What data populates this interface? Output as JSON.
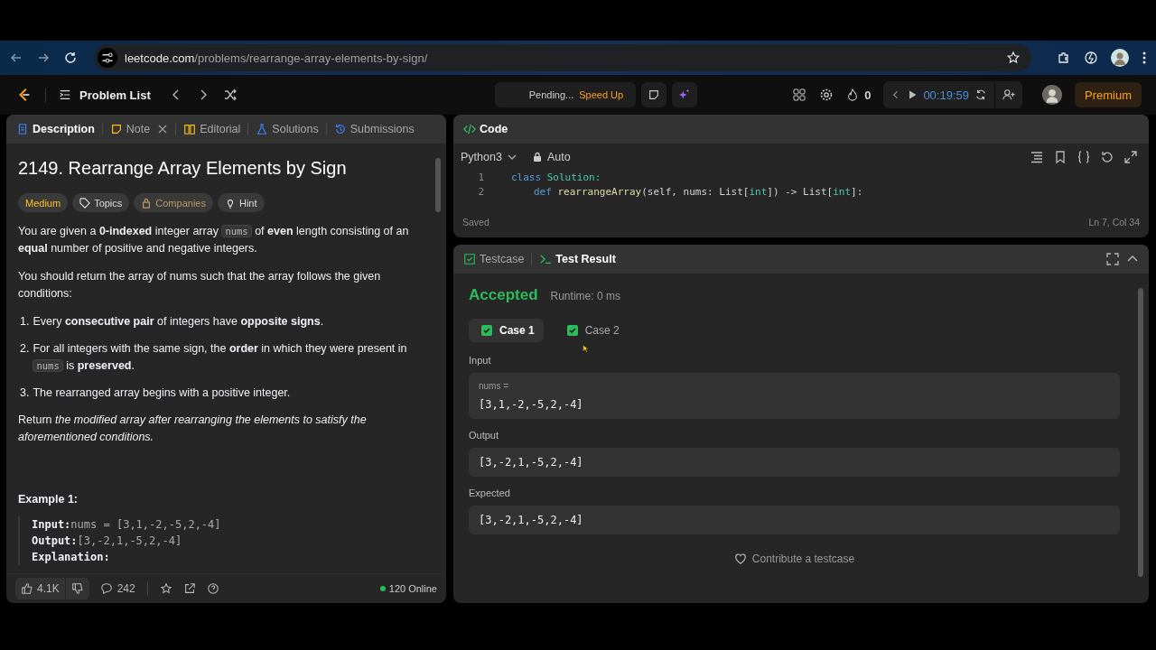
{
  "browser": {
    "url_host": "leetcode.com",
    "url_path": "/problems/rearrange-array-elements-by-sign/"
  },
  "nav": {
    "problem_list": "Problem List",
    "status": "Pending...",
    "speed_up": "Speed Up",
    "streak": "0",
    "timer": "00:19:59",
    "premium": "Premium"
  },
  "left_tabs": [
    {
      "label": "Description",
      "kind": "description",
      "selected": true,
      "closable": false
    },
    {
      "label": "Note",
      "kind": "note",
      "selected": false,
      "closable": true
    },
    {
      "label": "Editorial",
      "kind": "editorial",
      "selected": false,
      "closable": false
    },
    {
      "label": "Solutions",
      "kind": "solutions",
      "selected": false,
      "closable": false
    },
    {
      "label": "Submissions",
      "kind": "submissions",
      "selected": false,
      "closable": false
    }
  ],
  "problem": {
    "title": "2149. Rearrange Array Elements by Sign",
    "difficulty": "Medium",
    "tags": [
      {
        "label": "Topics",
        "kind": "topics"
      },
      {
        "label": "Companies",
        "kind": "companies"
      },
      {
        "label": "Hint",
        "kind": "hint"
      }
    ],
    "paragraphs": [
      [
        {
          "kind": "text",
          "text": "You are given a **0-indexed** integer array "
        },
        {
          "kind": "code",
          "text": "nums"
        },
        {
          "kind": "text",
          "text": " of **even** length consisting of an **equal** number of positive and negative integers."
        }
      ],
      [
        {
          "kind": "text",
          "text": "You should return the array of nums such that the array follows the given conditions:"
        }
      ]
    ],
    "conditions": [
      {
        "number": "1.",
        "parts": [
          {
            "kind": "text",
            "text": "Every **consecutive pair** of integers have **opposite signs**."
          }
        ]
      },
      {
        "number": "2.",
        "parts": [
          {
            "kind": "text",
            "text": "For all integers with the same sign, the **order** in which they were present in "
          },
          {
            "kind": "code",
            "text": "nums"
          },
          {
            "kind": "text",
            "text": " is **preserved**."
          }
        ]
      },
      {
        "number": "3.",
        "parts": [
          {
            "kind": "text",
            "text": "The rearranged array begins with a positive integer."
          }
        ]
      }
    ],
    "closing": "Return *the modified array after rearranging the elements to satisfy the aforementioned conditions.*",
    "example": {
      "title": "Example 1:",
      "lines": [
        {
          "label": "Input:",
          "value": "nums = [3,1,-2,-5,2,-4]"
        },
        {
          "label": "Output:",
          "value": "[3,-2,1,-5,2,-4]"
        },
        {
          "label": "Explanation:"
        }
      ]
    }
  },
  "footer": {
    "likes": "4.1K",
    "comments": "242",
    "online": "120 Online"
  },
  "code": {
    "title": "Code",
    "language": "Python3",
    "mode": "Auto",
    "lines": [
      {
        "number": "1",
        "tokens": [
          {
            "kind": "kw",
            "text": "class"
          },
          {
            "kind": "type",
            "text": " Solution:"
          }
        ],
        "children": [
          {
            "number": "2",
            "tokens": [
              {
                "kind": "kw",
                "text": "def"
              },
              {
                "kind": "fn",
                "text": " rearrangeArray"
              },
              {
                "kind": "plain",
                "text": "(self, nums: List["
              },
              {
                "kind": "type",
                "text": "int"
              },
              {
                "kind": "plain",
                "text": "]) -> List["
              },
              {
                "kind": "type",
                "text": "int"
              },
              {
                "kind": "plain",
                "text": "]:"
              }
            ]
          }
        ]
      }
    ],
    "status": "Saved",
    "position": "Ln 7, Col 34"
  },
  "result_tabs": [
    {
      "label": "Testcase",
      "kind": "testcase",
      "selected": false
    },
    {
      "label": "Test Result",
      "kind": "result",
      "selected": true
    }
  ],
  "result": {
    "verdict": "Accepted",
    "runtime": "Runtime: 0 ms",
    "cases": [
      {
        "label": "Case 1",
        "selected": true,
        "passed": true
      },
      {
        "label": "Case 2",
        "selected": false,
        "passed": true
      }
    ],
    "sections": [
      {
        "label": "Input",
        "variable": "nums =",
        "value": "[3,1,-2,-5,2,-4]"
      },
      {
        "label": "Output",
        "value": "[3,-2,1,-5,2,-4]"
      },
      {
        "label": "Expected",
        "value": "[3,-2,1,-5,2,-4]"
      }
    ],
    "contribute": "Contribute a testcase"
  }
}
